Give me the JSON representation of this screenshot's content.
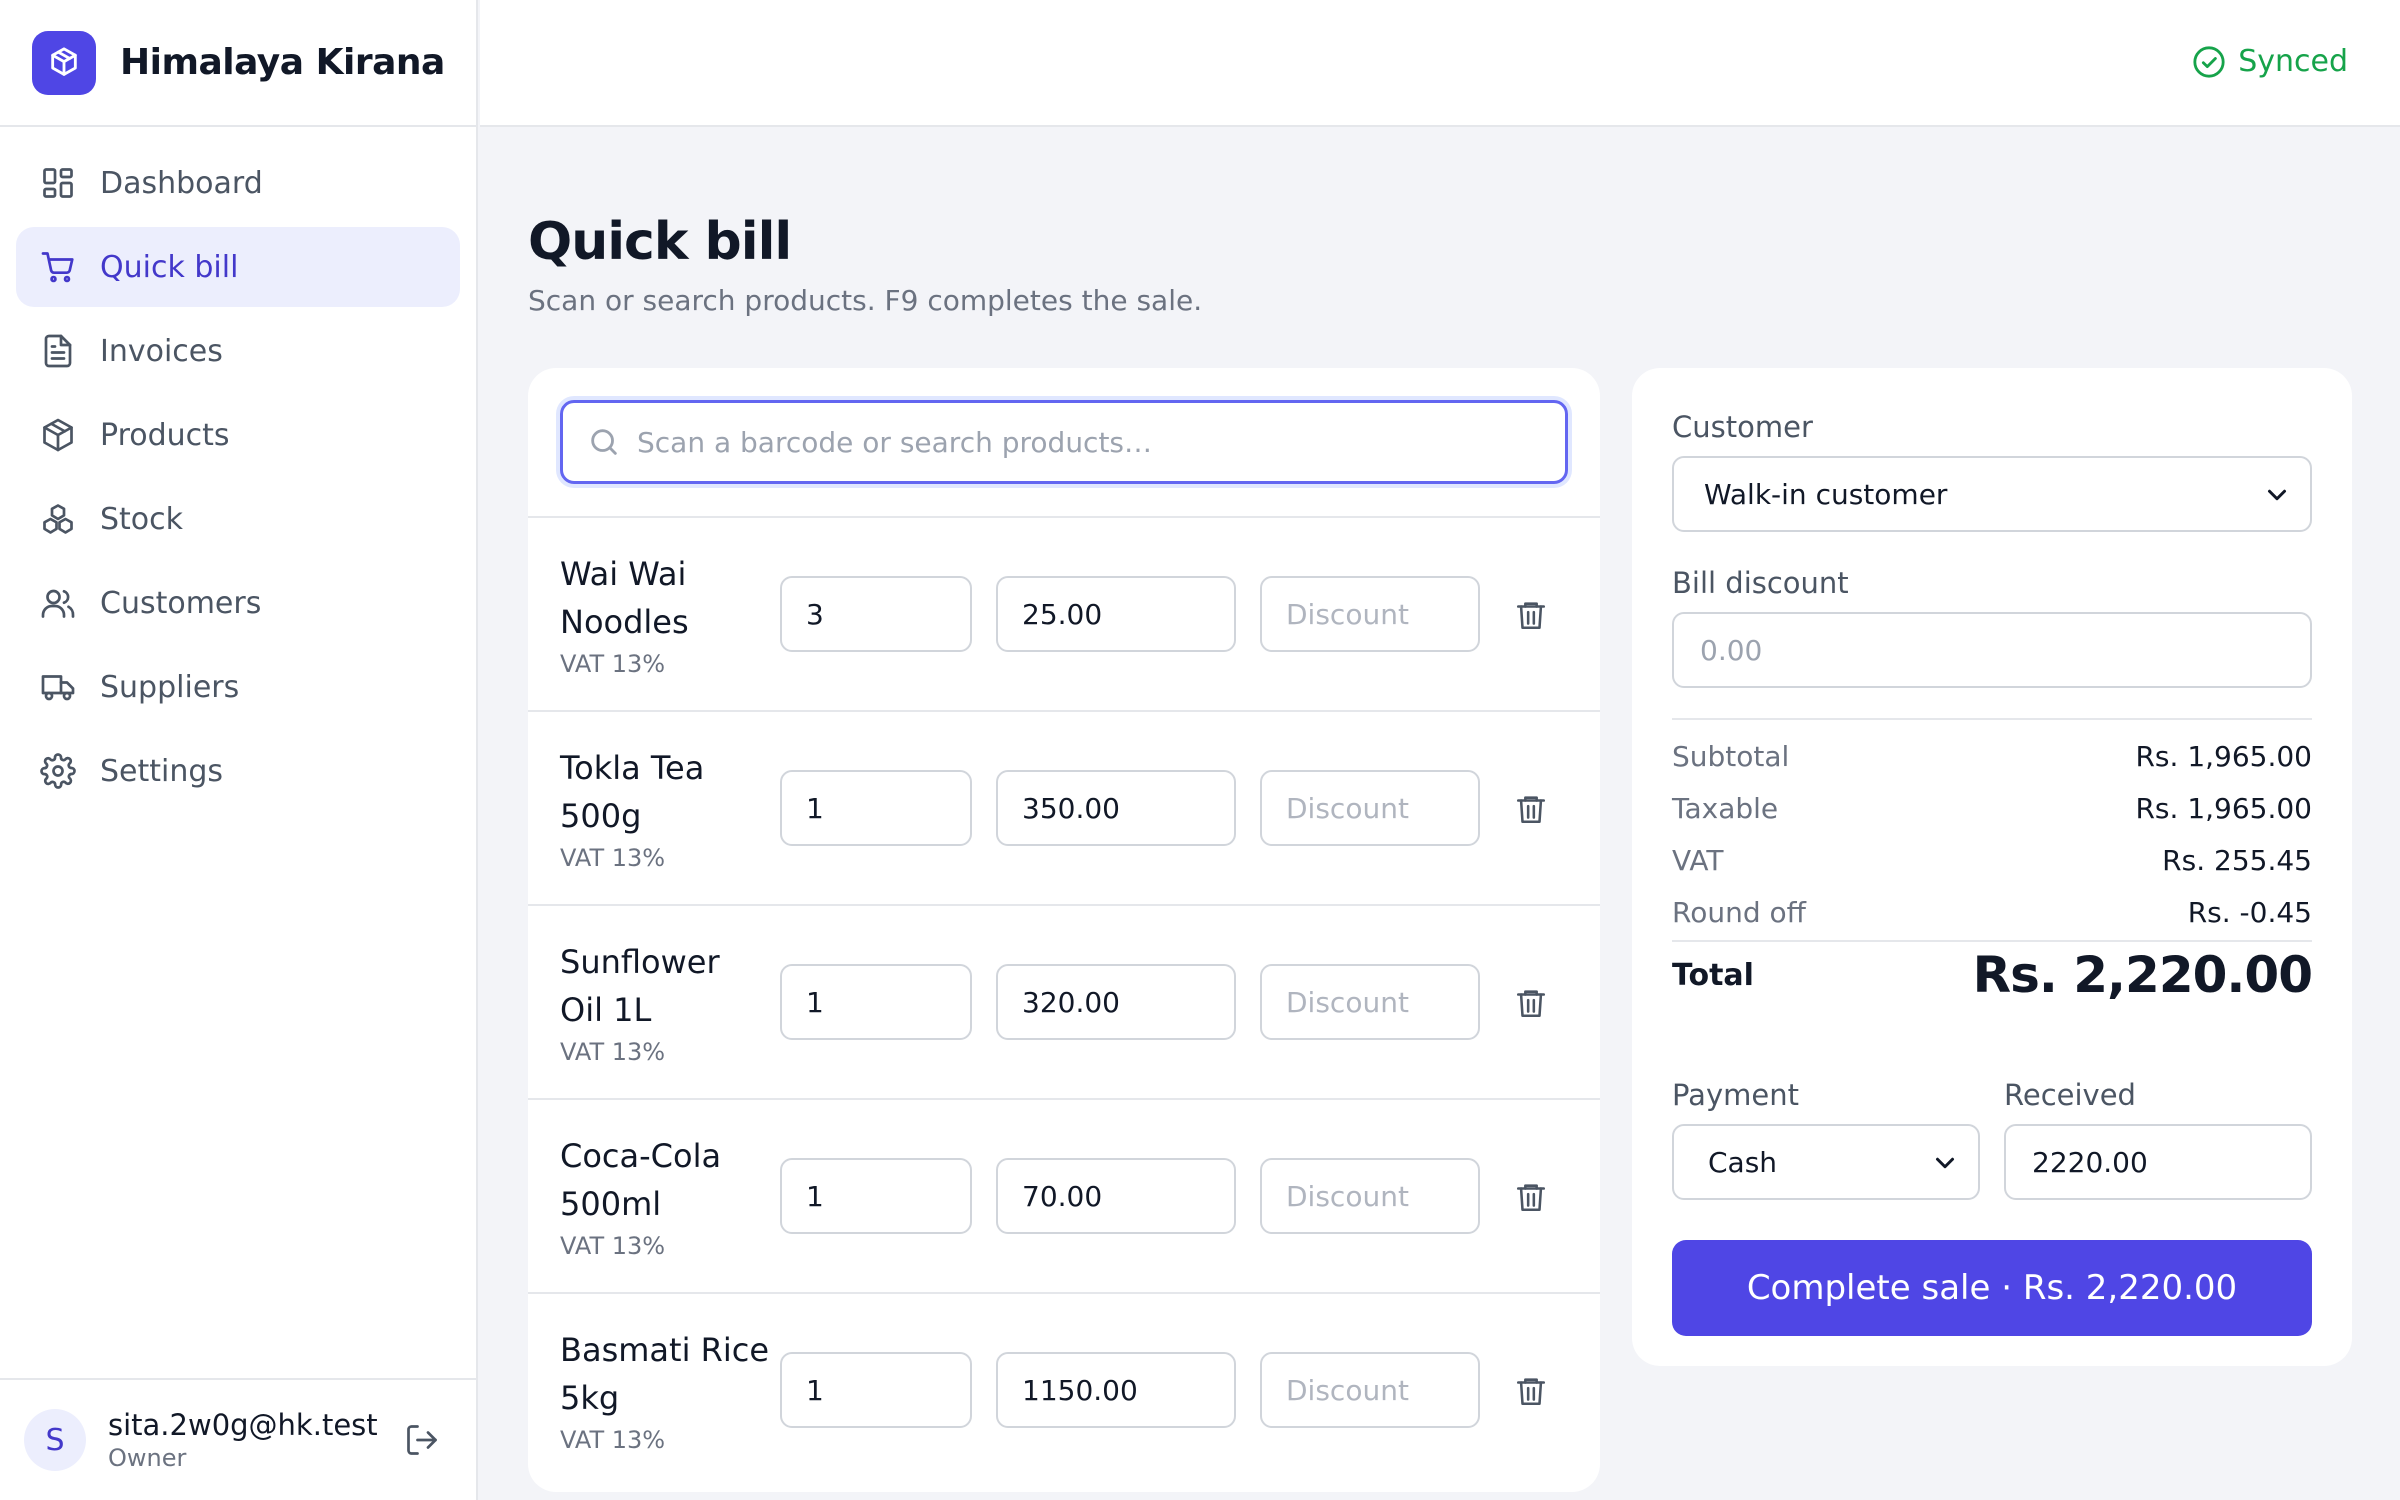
{
  "brand": {
    "name": "Himalaya Kirana"
  },
  "status": {
    "synced_label": "Synced"
  },
  "nav": {
    "items": [
      {
        "label": "Dashboard"
      },
      {
        "label": "Quick bill"
      },
      {
        "label": "Invoices"
      },
      {
        "label": "Products"
      },
      {
        "label": "Stock"
      },
      {
        "label": "Customers"
      },
      {
        "label": "Suppliers"
      },
      {
        "label": "Settings"
      }
    ]
  },
  "user": {
    "initial": "S",
    "email": "sita.2w0g@hk.test",
    "role": "Owner"
  },
  "page": {
    "title": "Quick bill",
    "subtitle": "Scan or search products. F9 completes the sale."
  },
  "search": {
    "placeholder": "Scan a barcode or search products…"
  },
  "line_items": [
    {
      "name": "Wai Wai Noodles",
      "vat": "VAT 13%",
      "qty": "3",
      "price": "25.00",
      "discount_placeholder": "Discount"
    },
    {
      "name": "Tokla Tea 500g",
      "vat": "VAT 13%",
      "qty": "1",
      "price": "350.00",
      "discount_placeholder": "Discount"
    },
    {
      "name": "Sunflower Oil 1L",
      "vat": "VAT 13%",
      "qty": "1",
      "price": "320.00",
      "discount_placeholder": "Discount"
    },
    {
      "name": "Coca-Cola 500ml",
      "vat": "VAT 13%",
      "qty": "1",
      "price": "70.00",
      "discount_placeholder": "Discount"
    },
    {
      "name": "Basmati Rice 5kg",
      "vat": "VAT 13%",
      "qty": "1",
      "price": "1150.00",
      "discount_placeholder": "Discount"
    }
  ],
  "summary": {
    "customer_label": "Customer",
    "customer_value": "Walk-in customer",
    "bill_discount_label": "Bill discount",
    "bill_discount_placeholder": "0.00",
    "subtotal_label": "Subtotal",
    "subtotal_value": "Rs. 1,965.00",
    "taxable_label": "Taxable",
    "taxable_value": "Rs. 1,965.00",
    "vat_label": "VAT",
    "vat_value": "Rs. 255.45",
    "roundoff_label": "Round off",
    "roundoff_value": "Rs. -0.45",
    "total_label": "Total",
    "total_value": "Rs. 2,220.00",
    "payment_label": "Payment",
    "payment_value": "Cash",
    "received_label": "Received",
    "received_value": "2220.00",
    "complete_label": "Complete sale · Rs. 2,220.00"
  },
  "colors": {
    "accent": "#4f46e5",
    "accent_soft": "#eceefd",
    "success": "#16a34a"
  }
}
